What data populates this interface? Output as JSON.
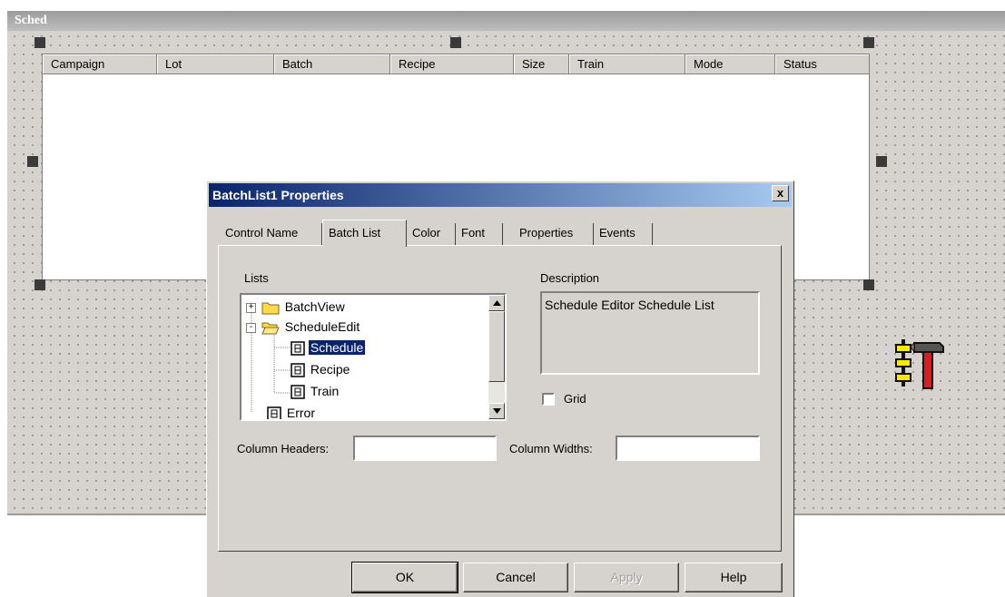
{
  "form": {
    "title": "Sched",
    "batchlist": {
      "columns": [
        "Campaign",
        "Lot",
        "Batch",
        "Recipe",
        "Size",
        "Train",
        "Mode",
        "Status"
      ]
    },
    "toolbox_icon": "toolbox-hammer-icon"
  },
  "dialog": {
    "title": "BatchList1 Properties",
    "close_label": "x",
    "tabs": [
      "Control Name",
      "Batch List",
      "Color",
      "Font",
      "Properties",
      "Events"
    ],
    "active_tab": "Batch List",
    "lists_label": "Lists",
    "tree": [
      {
        "label": "BatchView",
        "icon": "folder-icon",
        "expander": "+"
      },
      {
        "label": "ScheduleEdit",
        "icon": "open-folder-icon",
        "expander": "-"
      },
      {
        "label": "Schedule",
        "icon": "list-doc-icon",
        "selected": true
      },
      {
        "label": "Recipe",
        "icon": "list-doc-icon"
      },
      {
        "label": "Train",
        "icon": "list-doc-icon"
      },
      {
        "label": "Error",
        "icon": "list-doc-icon"
      }
    ],
    "description_label": "Description",
    "description_text": "Schedule Editor Schedule List",
    "grid_label": "Grid",
    "grid_checked": false,
    "column_headers_label": "Column Headers:",
    "column_headers_value": "",
    "column_widths_label": "Column Widths:",
    "column_widths_value": "",
    "buttons": {
      "ok": "OK",
      "cancel": "Cancel",
      "apply": "Apply",
      "help": "Help"
    }
  },
  "colors": {
    "title_bar_start": "#0a246a",
    "title_bar_end": "#a6caf0",
    "selection": "#0a246a",
    "face": "#d6d3ce"
  }
}
